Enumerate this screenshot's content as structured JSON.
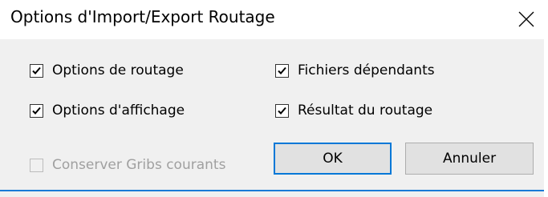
{
  "dialog": {
    "title": "Options d'Import/Export Routage",
    "close_icon": "close-icon"
  },
  "options": {
    "routing_options": {
      "label": "Options de routage",
      "checked": true
    },
    "display_options": {
      "label": "Options d'affichage",
      "checked": true
    },
    "keep_gribs": {
      "label": "Conserver Gribs courants",
      "checked": false,
      "enabled": false
    },
    "dependent_files": {
      "label": "Fichiers dépendants",
      "checked": true
    },
    "routing_result": {
      "label": "Résultat du routage",
      "checked": true
    }
  },
  "buttons": {
    "ok_label": "OK",
    "cancel_label": "Annuler"
  },
  "colors": {
    "accent": "#0078d7",
    "bottom_border": "#1a7ad6",
    "dialog_bg": "#f0f0f0"
  }
}
